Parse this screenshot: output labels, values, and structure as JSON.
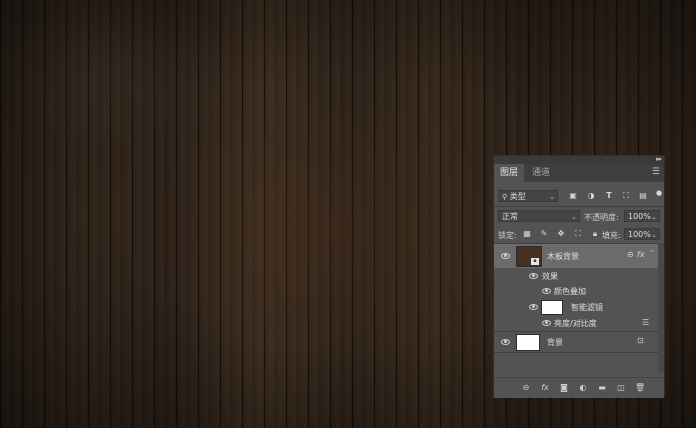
{
  "panel": {
    "tabs": [
      {
        "label": "图层",
        "active": true
      },
      {
        "label": "通道",
        "active": false
      }
    ],
    "filter_kind": "类型",
    "blend_mode": "正常",
    "opacity_label": "不透明度:",
    "opacity_value": "100%",
    "lock_label": "锁定:",
    "fill_label": "填充:",
    "fill_value": "100%",
    "layers": [
      {
        "name": "木板背景",
        "selected": true
      },
      {
        "name": "效果"
      },
      {
        "name": "颜色叠加"
      },
      {
        "name": "智能滤镜"
      },
      {
        "name": "亮度/对比度"
      },
      {
        "name": "背景"
      }
    ],
    "smart_object_fx": "fx",
    "bottom_fx": "fx"
  },
  "colors": {
    "panel_bg": "#535353",
    "tab_bar": "#3e3e3e",
    "selected_row": "#6b6b6b",
    "wood_dark": "#2a2017"
  },
  "icons": [
    "search-icon",
    "chevron-down-icon",
    "eye-icon",
    "link-icon",
    "fx-icon",
    "mask-icon",
    "adjustment-icon",
    "folder-icon",
    "new-layer-icon",
    "trash-icon",
    "lock-icon"
  ]
}
